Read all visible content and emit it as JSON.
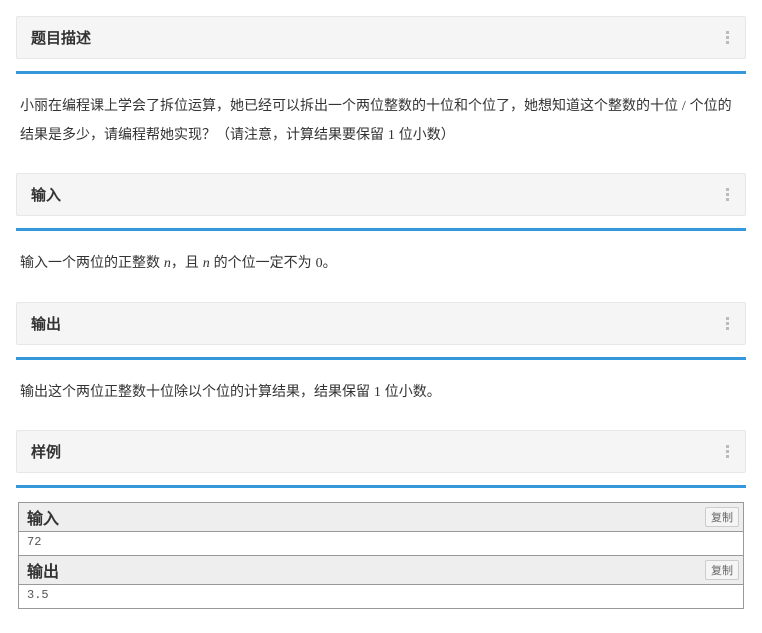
{
  "sections": {
    "desc": {
      "title": "题目描述",
      "body_parts": [
        "小丽在编程课上学会了拆位运算，她已经可以拆出一个两位整数的十位和个位了，她想知道这个整数的十位 ",
        "/",
        " 个位的结果是多少，请编程帮她实现？（请注意，计算结果要保留 ",
        "1",
        " 位小数）"
      ]
    },
    "input": {
      "title": "输入",
      "body_parts": [
        "输入一个两位的正整数 ",
        "n",
        "，且 ",
        "n",
        " 的个位一定不为 ",
        "0",
        "。"
      ]
    },
    "output": {
      "title": "输出",
      "body_parts": [
        "输出这个两位正整数十位除以个位的计算结果，结果保留 ",
        "1",
        " 位小数。"
      ]
    },
    "example": {
      "title": "样例",
      "input_label": "输入",
      "output_label": "输出",
      "copy_label": "复制",
      "input_value": "72",
      "output_value": "3.5"
    }
  }
}
